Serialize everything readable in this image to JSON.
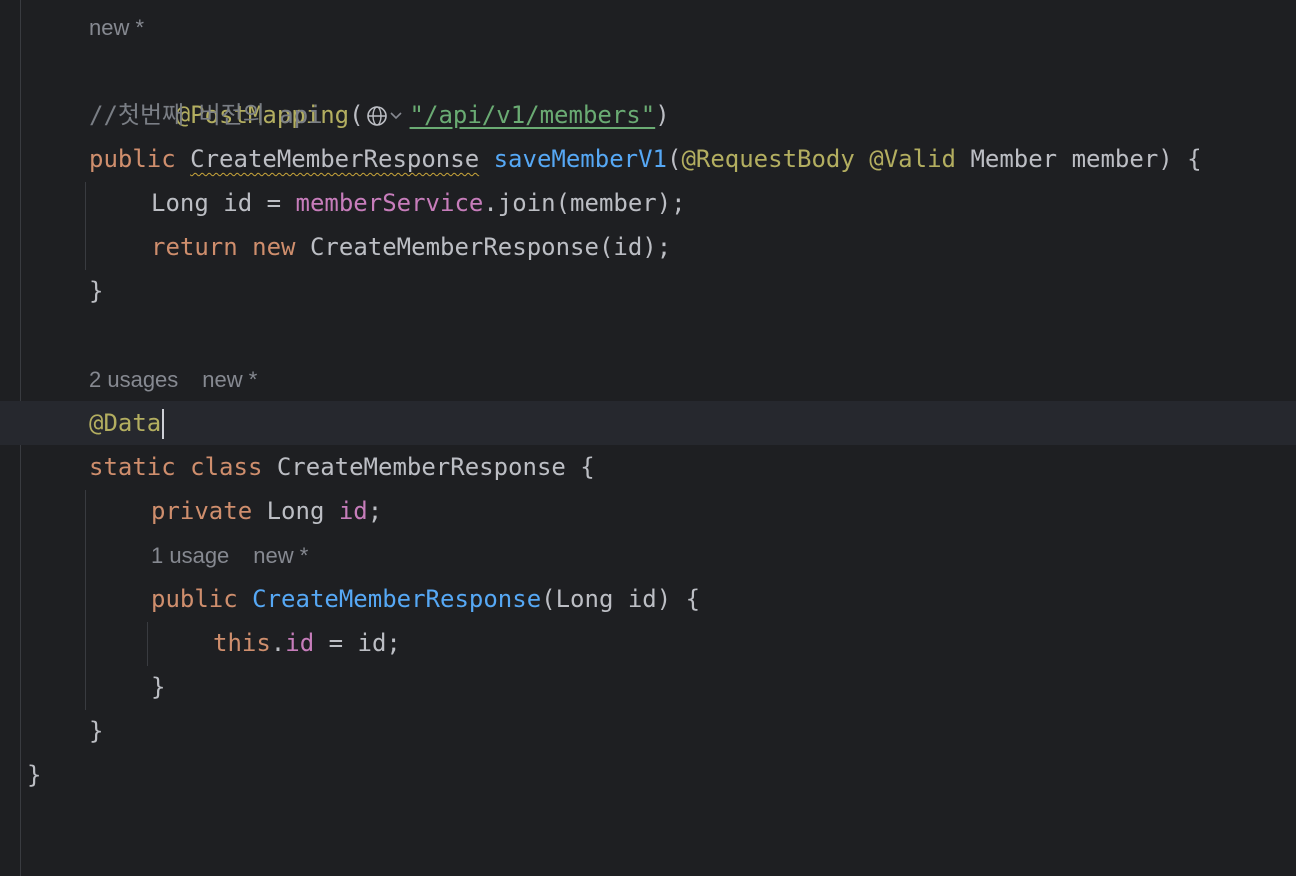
{
  "editor": {
    "lines": [
      {
        "hint": "new *"
      },
      {
        "annotation": "@PostMapping",
        "paren_open": "(",
        "string": "\"/api/v1/members\"",
        "paren_close": ")"
      },
      {
        "comment": "//첫번째 버전의 api"
      },
      {
        "kw_public": "public",
        "type": "CreateMemberResponse",
        "method": "saveMemberV1",
        "open": "(",
        "ann1": "@RequestBody",
        "ann2": "@Valid",
        "rest": "Member member) {"
      },
      {
        "text_a": "Long id = ",
        "field": "memberService",
        "text_b": ".join(member);"
      },
      {
        "kw_return": "return",
        "kw_new": "new",
        "rest": "CreateMemberResponse(id);"
      },
      {
        "brace": "}"
      },
      {
        "hint_a": "2 usages",
        "hint_b": "new *"
      },
      {
        "annotation": "@Data"
      },
      {
        "kw_static": "static",
        "kw_class": "class",
        "rest": "CreateMemberResponse {"
      },
      {
        "kw_private": "private",
        "type": "Long",
        "field": "id",
        "semi": ";"
      },
      {
        "hint_a": "1 usage",
        "hint_b": "new *"
      },
      {
        "kw_public": "public",
        "ctor": "CreateMemberResponse",
        "rest": "(Long id) {"
      },
      {
        "kw_this": "this",
        "dot": ".",
        "field": "id",
        "rest": " = id;"
      },
      {
        "brace": "}"
      },
      {
        "brace": "}"
      },
      {
        "brace": "}"
      }
    ]
  },
  "colors": {
    "background": "#1e1f22",
    "keyword": "#cf8e6d",
    "annotation": "#b3ae60",
    "method": "#56a8f5",
    "field": "#c77dbb",
    "string": "#6aab73",
    "comment": "#7a7e85",
    "text": "#bcbec4"
  },
  "icons": {
    "url_globe": "globe-icon",
    "dropdown": "chevron-down-icon"
  }
}
